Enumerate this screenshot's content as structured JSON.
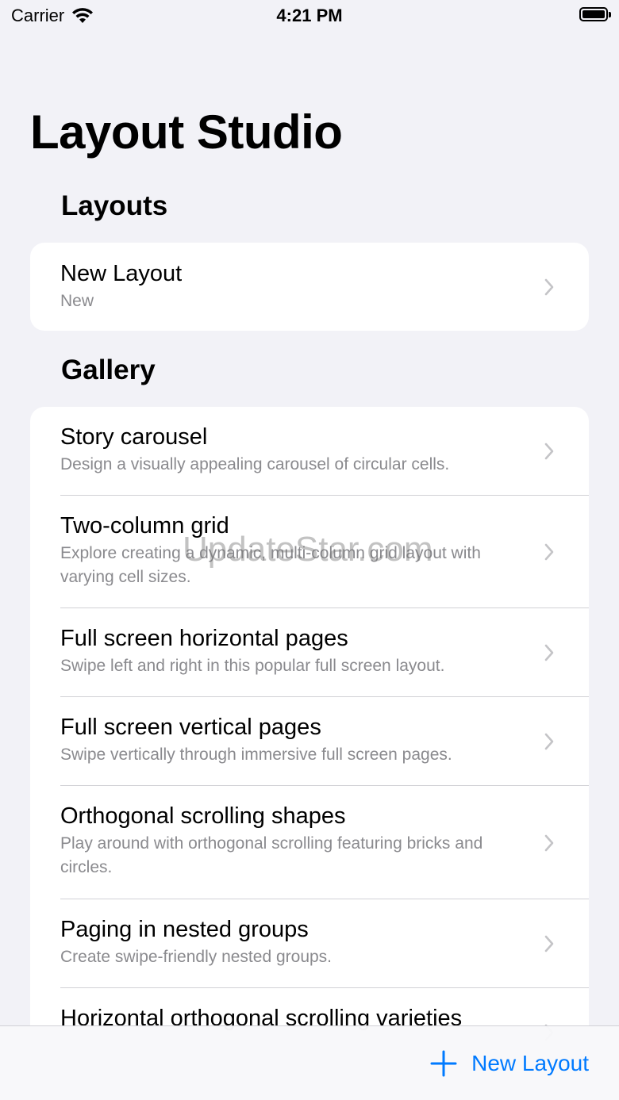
{
  "status_bar": {
    "carrier": "Carrier",
    "time": "4:21 PM",
    "wifi_icon": "wifi-icon",
    "battery_icon": "battery-icon"
  },
  "title": "Layout Studio",
  "sections": {
    "layouts": {
      "header": "Layouts",
      "items": [
        {
          "title": "New Layout",
          "subtitle": "New"
        }
      ]
    },
    "gallery": {
      "header": "Gallery",
      "items": [
        {
          "title": "Story carousel",
          "subtitle": "Design a visually appealing carousel of circular cells."
        },
        {
          "title": "Two-column grid",
          "subtitle": "Explore creating a dynamic, multi-column grid layout with varying cell sizes."
        },
        {
          "title": "Full screen horizontal pages",
          "subtitle": "Swipe left and right in this popular full screen layout."
        },
        {
          "title": "Full screen vertical pages",
          "subtitle": "Swipe vertically through immersive full screen pages."
        },
        {
          "title": "Orthogonal scrolling shapes",
          "subtitle": "Play around with orthogonal scrolling featuring bricks and circles."
        },
        {
          "title": "Paging in nested groups",
          "subtitle": "Create swipe-friendly nested groups."
        },
        {
          "title": "Horizontal orthogonal scrolling varieties",
          "subtitle": ""
        }
      ]
    }
  },
  "watermark": "UpdateStar.com",
  "toolbar": {
    "new_layout_label": "New Layout",
    "icon": "plus-icon"
  },
  "colors": {
    "accent": "#007aff",
    "background": "#f2f2f7",
    "card": "#ffffff",
    "secondary_text": "#8a8a8e"
  }
}
